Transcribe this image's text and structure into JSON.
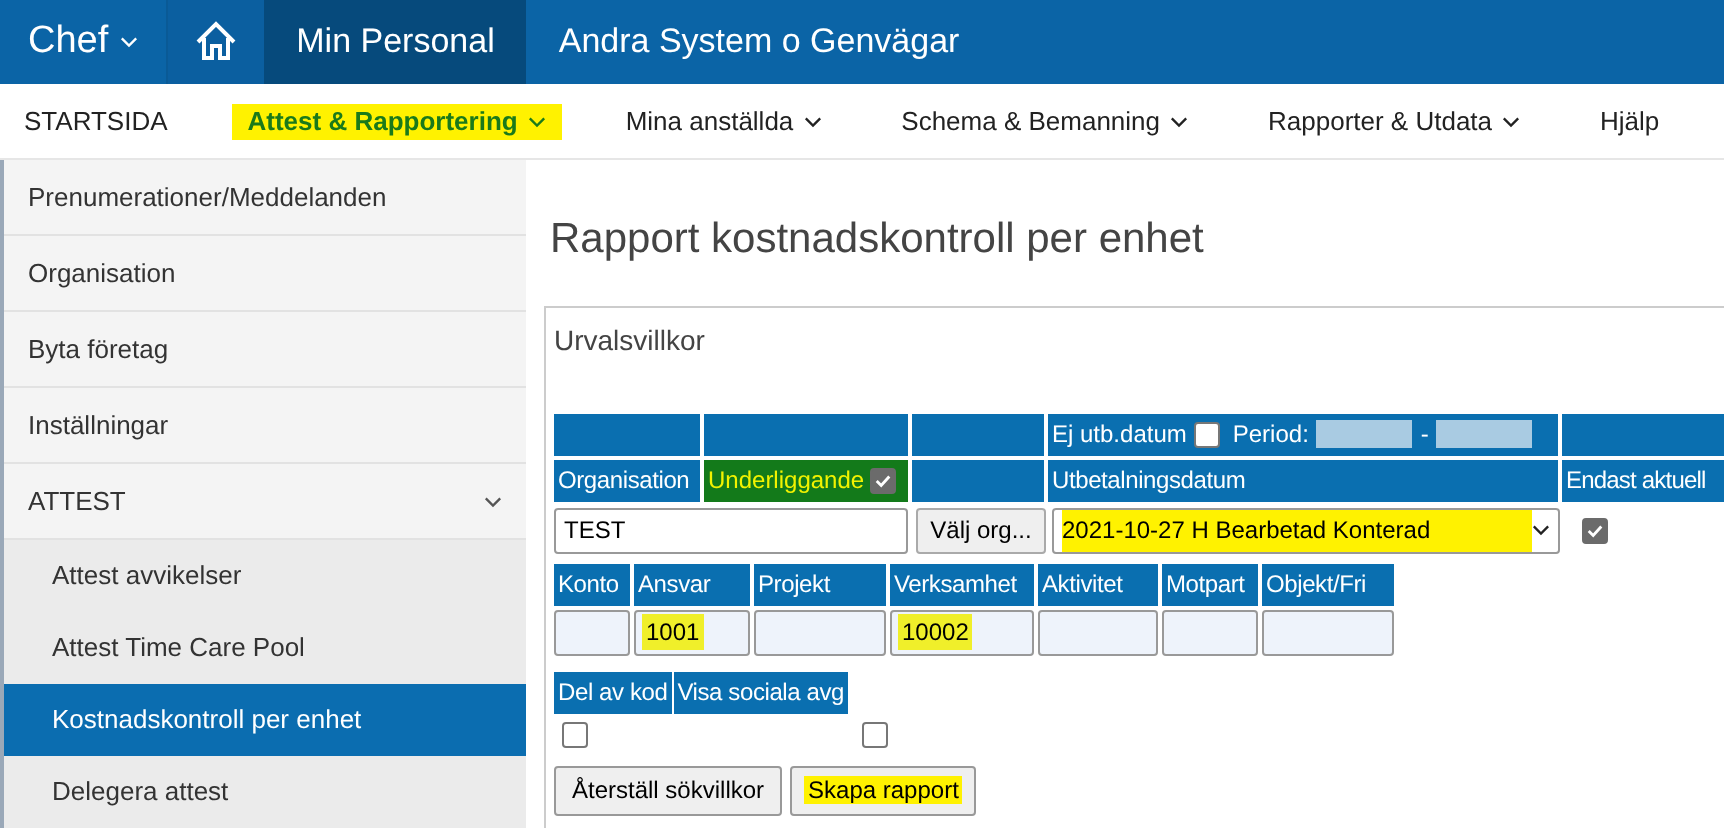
{
  "top_bar": {
    "role_menu": "Chef",
    "tabs": [
      {
        "label": "Min Personal",
        "selected": true
      },
      {
        "label": "Andra System o Genvägar",
        "selected": false
      }
    ]
  },
  "main_nav": [
    {
      "label": "STARTSIDA",
      "dropdown": false,
      "selected": false
    },
    {
      "label": "Attest & Rapportering",
      "dropdown": true,
      "selected": true
    },
    {
      "label": "Mina anställda",
      "dropdown": true,
      "selected": false
    },
    {
      "label": "Schema & Bemanning",
      "dropdown": true,
      "selected": false
    },
    {
      "label": "Rapporter & Utdata",
      "dropdown": true,
      "selected": false
    },
    {
      "label": "Hjälp",
      "dropdown": false,
      "selected": false
    }
  ],
  "sidebar": {
    "items": [
      {
        "label": "Prenumerationer/Meddelanden",
        "selected": false
      },
      {
        "label": "Organisation",
        "selected": false
      },
      {
        "label": "Byta företag",
        "selected": false
      },
      {
        "label": "Inställningar",
        "selected": false
      },
      {
        "label": "ATTEST",
        "selected": false,
        "expanded": true,
        "children": [
          {
            "label": "Attest avvikelser",
            "selected": false
          },
          {
            "label": "Attest Time Care Pool",
            "selected": false
          },
          {
            "label": "Kostnadskontroll per enhet",
            "selected": true
          },
          {
            "label": "Delegera attest",
            "selected": false
          }
        ]
      }
    ]
  },
  "page_title": "Rapport kostnadskontroll per enhet",
  "form": {
    "title": "Urvalsvillkor",
    "ej_utb_label": "Ej utb.datum",
    "ej_utb_checked": false,
    "period_label": "Period:",
    "period_separator": "-",
    "organisation_label": "Organisation",
    "underliggande_label": "Underliggande",
    "underliggande_checked": true,
    "underliggande_highlighted": true,
    "utbetalningsdatum_label": "Utbetalningsdatum",
    "endast_label": "Endast aktuell",
    "organisation_value": "TEST",
    "choose_org_button": "Välj org...",
    "utbetalningsdatum_value": "2021-10-27 H Bearbetad Konterad",
    "utbetalningsdatum_highlighted": true,
    "endast_checked": true,
    "code_fields": [
      {
        "label": "Konto"
      },
      {
        "label": "Ansvar",
        "value": "1001",
        "highlighted": true
      },
      {
        "label": "Projekt"
      },
      {
        "label": "Verksamhet",
        "value": "10002",
        "highlighted": true
      },
      {
        "label": "Aktivitet"
      },
      {
        "label": "Motpart"
      },
      {
        "label": "Objekt/Fri"
      }
    ],
    "options": [
      {
        "label": "Del av kod",
        "checked": false
      },
      {
        "label": "Visa sociala avg",
        "checked": false
      }
    ],
    "buttons": [
      {
        "label": "Återställ sökvillkor",
        "highlighted": false
      },
      {
        "label": "Skapa rapport",
        "highlighted": true
      }
    ]
  }
}
